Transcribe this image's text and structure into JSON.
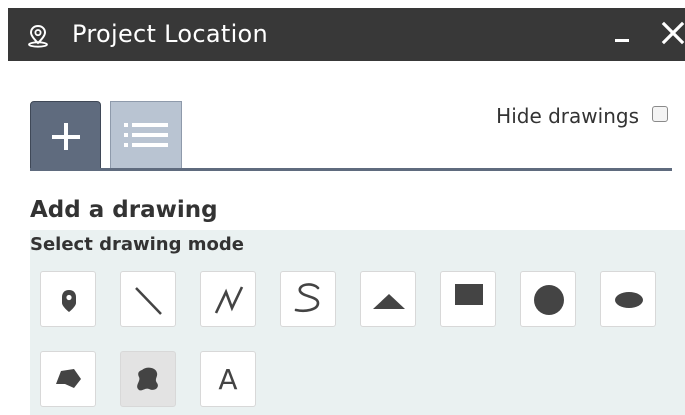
{
  "window": {
    "title": "Project Location",
    "title_icon": "location-pin-icon",
    "minimize_icon": "minimize-icon",
    "close_icon": "close-icon"
  },
  "tabs": [
    {
      "name": "add-drawing",
      "icon": "plus-icon",
      "selected": true
    },
    {
      "name": "drawings-list",
      "icon": "list-icon",
      "selected": false
    }
  ],
  "hide_drawings": {
    "label": "Hide drawings",
    "checked": false
  },
  "add_drawing": {
    "title": "Add a drawing",
    "mode_label": "Select drawing mode",
    "tools": [
      {
        "icon": "point-icon",
        "active": false
      },
      {
        "icon": "line-icon",
        "active": false
      },
      {
        "icon": "polyline-icon",
        "active": false
      },
      {
        "icon": "freehand-line-icon",
        "active": false
      },
      {
        "icon": "triangle-icon",
        "active": false
      },
      {
        "icon": "rectangle-icon",
        "active": false
      },
      {
        "icon": "circle-icon",
        "active": false
      },
      {
        "icon": "ellipse-icon",
        "active": false
      },
      {
        "icon": "polygon-icon",
        "active": false
      },
      {
        "icon": "freehand-polygon-icon",
        "active": true
      },
      {
        "icon": "text-icon",
        "label": "A",
        "active": false
      }
    ]
  },
  "colors": {
    "titlebar": "#383838",
    "tab_selected": "#5f6b7e",
    "tab_unselected": "#b9c4d2",
    "panel_bg": "#eaf1f1",
    "icon_fill": "#444444"
  }
}
